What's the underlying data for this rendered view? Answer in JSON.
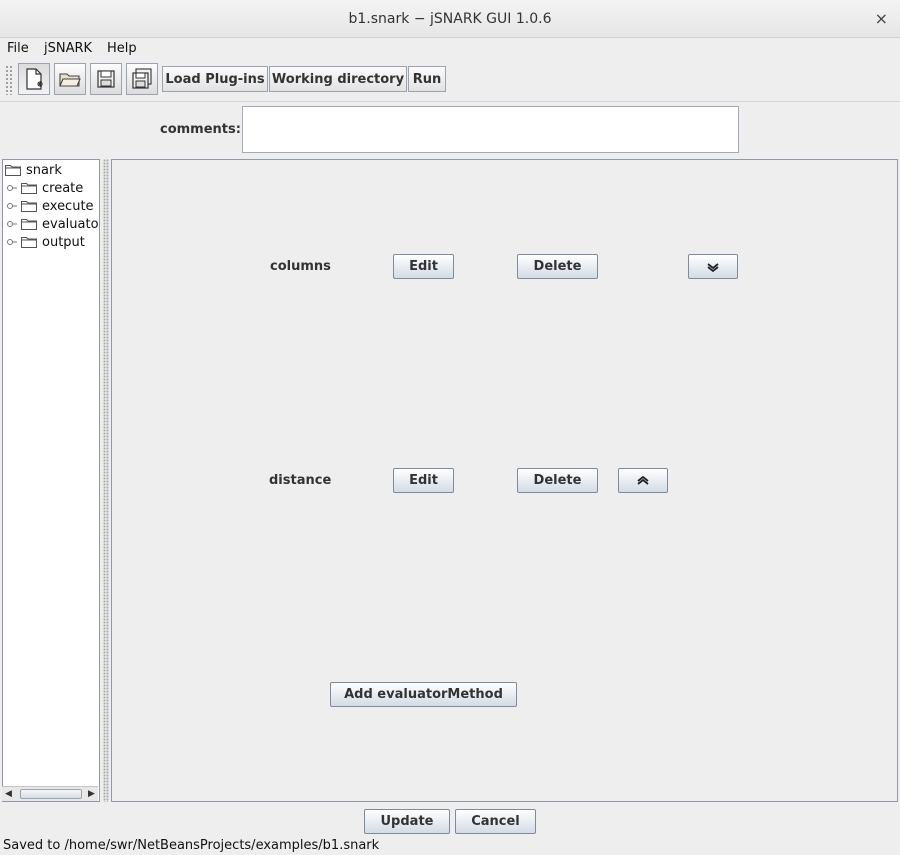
{
  "window": {
    "title": "b1.snark − jSNARK GUI 1.0.6",
    "close_glyph": "×"
  },
  "menu": {
    "file": "File",
    "jsnark": "jSNARK",
    "help": "Help"
  },
  "toolbar": {
    "icons": [
      "new-document-icon",
      "open-folder-icon",
      "save-icon",
      "save-as-icon"
    ],
    "load_plugins": "Load Plug-ins",
    "working_directory": "Working directory",
    "run": "Run"
  },
  "comments": {
    "label": "comments:",
    "value": ""
  },
  "tree": {
    "root": "snark",
    "children": [
      "create",
      "execute",
      "evaluator",
      "output"
    ]
  },
  "panel": {
    "rows": [
      {
        "name": "columns",
        "edit": "Edit",
        "delete": "Delete",
        "move": "move-down"
      },
      {
        "name": "distance",
        "edit": "Edit",
        "delete": "Delete",
        "move": "move-up"
      }
    ],
    "add_button": "Add evaluatorMethod"
  },
  "footer": {
    "update": "Update",
    "cancel": "Cancel"
  },
  "status": "Saved to /home/swr/NetBeansProjects/examples/b1.snark",
  "colors": {
    "background": "#eeeeee",
    "border": "#8f99a6",
    "button_top": "#ffffff",
    "button_bottom": "#d3dbe6"
  }
}
